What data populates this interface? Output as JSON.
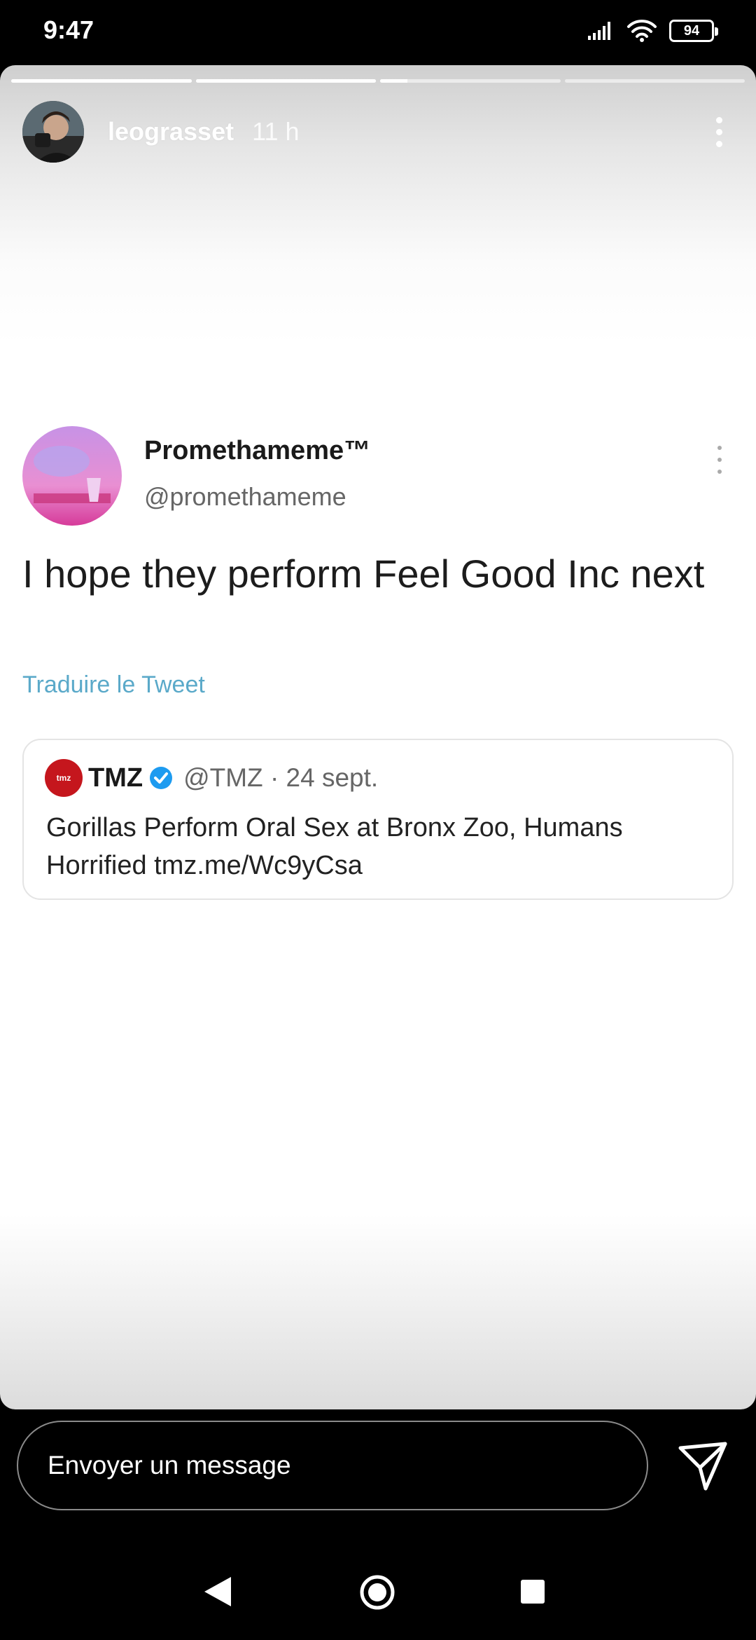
{
  "status_bar": {
    "time": "9:47",
    "battery": "94",
    "icons": [
      "signal-icon",
      "wifi-icon",
      "battery-icon"
    ]
  },
  "story": {
    "progress": [
      1.0,
      1.0,
      0.15,
      0.0
    ],
    "username": "leograsset",
    "time_ago": "11 h",
    "more_icon": "more-vertical-icon"
  },
  "tweet": {
    "display_name": "Promethameme™",
    "handle": "@promethameme",
    "text": "I hope they perform Feel Good Inc next",
    "translate_link": "Traduire le Tweet",
    "quoted": {
      "name": "TMZ",
      "handle_date": "@TMZ · 24 sept.",
      "text": "Gorillas Perform Oral Sex at Bronx Zoo, Humans Horrified tmz.me/Wc9yCsa",
      "logo_text": "tmz",
      "verified_color": "#1d9bf0"
    },
    "link_color": "#5aa9c9"
  },
  "composer": {
    "placeholder": "Envoyer un message",
    "send_icon": "send-icon"
  },
  "nav_bar": {
    "icons": [
      "back-icon",
      "home-icon",
      "recents-icon"
    ]
  }
}
